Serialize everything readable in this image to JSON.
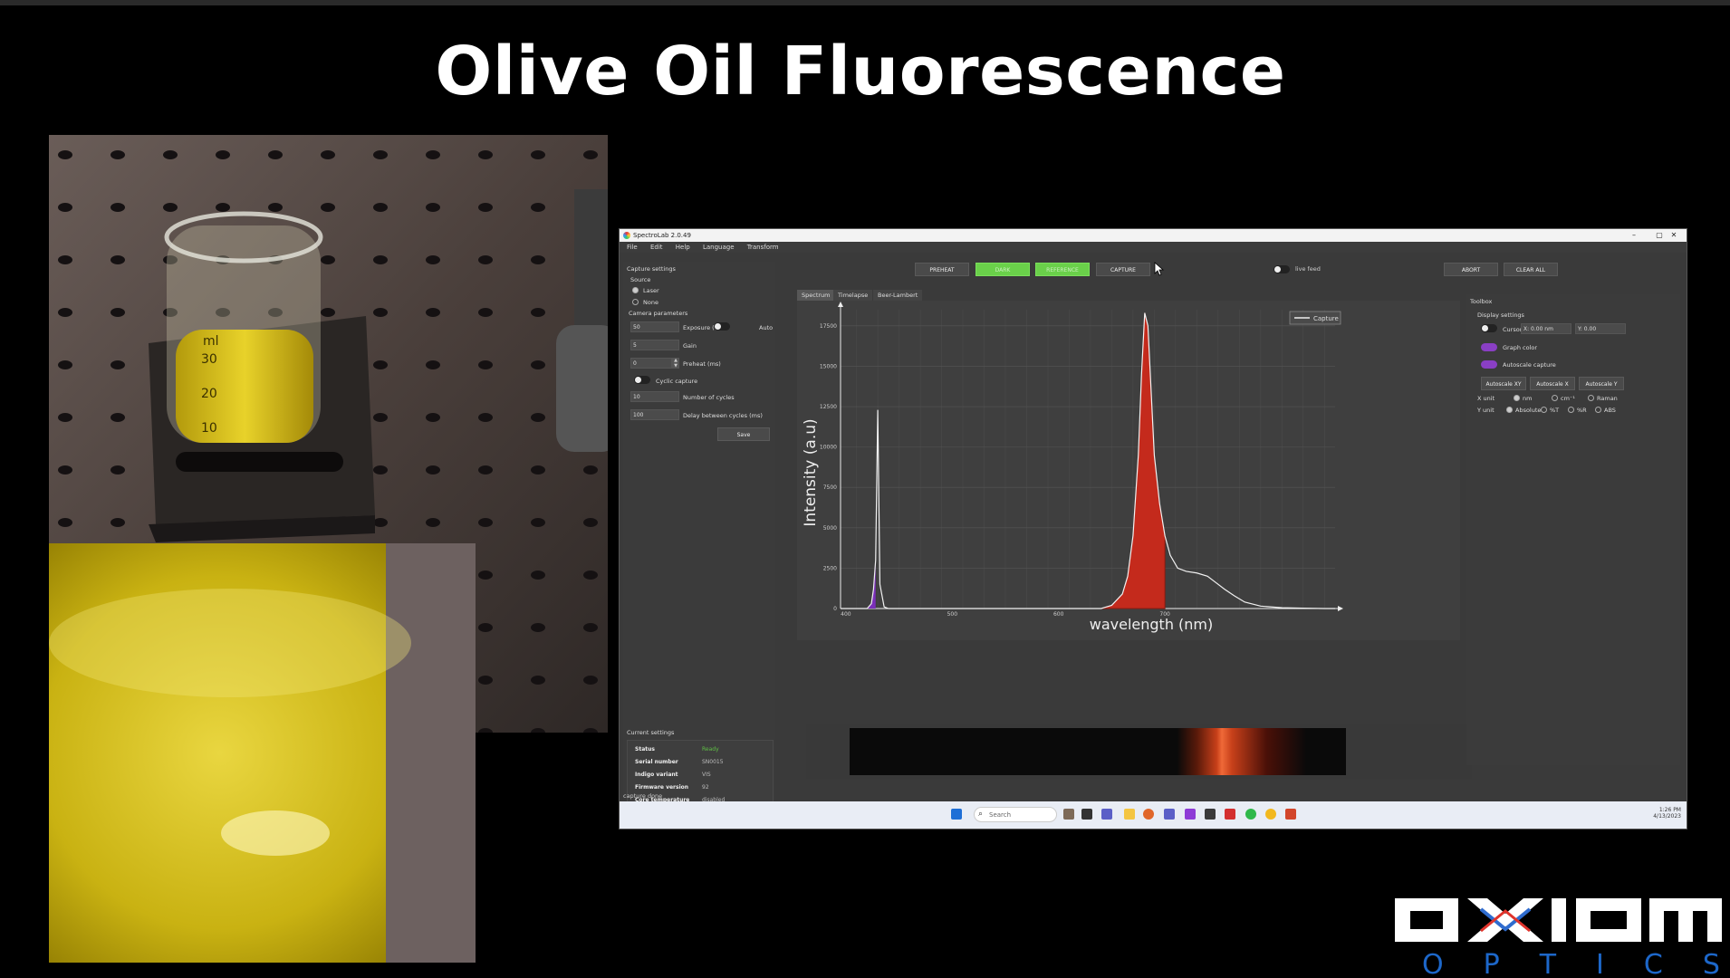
{
  "slide": {
    "title": "Olive Oil Fluorescence",
    "brand": {
      "logo_text": "axiom",
      "sub_text": "OPTICS"
    }
  },
  "photos": {
    "beaker_scale": [
      "ml",
      "30",
      "20",
      "10"
    ]
  },
  "app": {
    "window_title": "SpectroLab 2.0.49",
    "window_controls": [
      "–",
      "▢",
      "✕"
    ],
    "menu": [
      "File",
      "Edit",
      "Help",
      "Language",
      "Transform"
    ],
    "toolbar": {
      "preheat": "PREHEAT",
      "dark": "DARK",
      "reference": "REFERENCE",
      "capture": "CAPTURE",
      "live_feed": "live feed",
      "abort": "ABORT",
      "clear_all": "CLEAR ALL"
    },
    "capture_settings": {
      "heading": "Capture settings",
      "source_label": "Source",
      "source_options": [
        "Laser",
        "None"
      ],
      "camera_heading": "Camera parameters",
      "exposure_value": "50",
      "exposure_label": "Exposure (ms)",
      "auto_label": "Auto",
      "gain_value": "5",
      "gain_label": "Gain",
      "preheat_value": "0",
      "preheat_label": "Preheat (ms)",
      "cyclic_label": "Cyclic capture",
      "cycles_value": "10",
      "cycles_label": "Number of cycles",
      "delay_value": "100",
      "delay_label": "Delay between cycles (ms)",
      "save": "Save"
    },
    "current_settings": {
      "heading": "Current settings",
      "rows": [
        {
          "key": "Status",
          "value": "Ready"
        },
        {
          "key": "Serial number",
          "value": "SN0015"
        },
        {
          "key": "Indigo variant",
          "value": "VIS"
        },
        {
          "key": "Firmware version",
          "value": "92"
        },
        {
          "key": "Core temperature",
          "value": "disabled"
        }
      ]
    },
    "status_bar": "capture done",
    "tabs": [
      "Spectrum",
      "Timelapse",
      "Beer-Lambert"
    ],
    "toolbox": {
      "heading": "Toolbox",
      "display_heading": "Display settings",
      "cursors_label": "Cursors",
      "cursor_x": "X: 0.00 nm",
      "cursor_y": "Y: 0.00",
      "graph_color": "Graph color",
      "autoscale_capture": "Autoscale capture",
      "autoscale_xy": "Autoscale XY",
      "autoscale_x": "Autoscale X",
      "autoscale_y": "Autoscale Y",
      "x_unit_label": "X unit",
      "x_units": [
        "nm",
        "cm⁻¹",
        "Raman"
      ],
      "y_unit_label": "Y unit",
      "y_units": [
        "Absolute",
        "%T",
        "%R",
        "ABS"
      ]
    },
    "taskbar": {
      "search_placeholder": "Search",
      "time": "1:26 PM",
      "date": "4/13/2023"
    }
  },
  "chart_data": {
    "type": "area",
    "title": "",
    "xlabel": "wavelength (nm)",
    "ylabel": "Intensity (a.u)",
    "xlim": [
      395,
      860
    ],
    "ylim": [
      0,
      18500
    ],
    "x_ticks": [
      400,
      500,
      600,
      700
    ],
    "y_ticks": [
      0,
      2500,
      5000,
      7500,
      10000,
      12500,
      15000,
      17500
    ],
    "legend": {
      "placement": "top-right",
      "entries": [
        "Capture"
      ]
    },
    "grid": true,
    "series": [
      {
        "name": "Capture",
        "x": [
          395,
          400,
          420,
          424,
          426,
          428,
          430,
          432,
          436,
          440,
          500,
          600,
          640,
          650,
          660,
          665,
          670,
          675,
          678,
          681,
          684,
          687,
          690,
          695,
          700,
          705,
          712,
          720,
          730,
          740,
          748,
          756,
          765,
          775,
          790,
          810,
          830,
          850,
          860
        ],
        "y": [
          0,
          0,
          0,
          300,
          1200,
          3000,
          12300,
          1500,
          100,
          0,
          0,
          0,
          0,
          200,
          900,
          2000,
          4500,
          9500,
          14500,
          18300,
          17500,
          13500,
          9500,
          6500,
          4500,
          3300,
          2500,
          2300,
          2200,
          2000,
          1600,
          1200,
          800,
          400,
          150,
          50,
          20,
          0,
          0
        ]
      }
    ]
  }
}
